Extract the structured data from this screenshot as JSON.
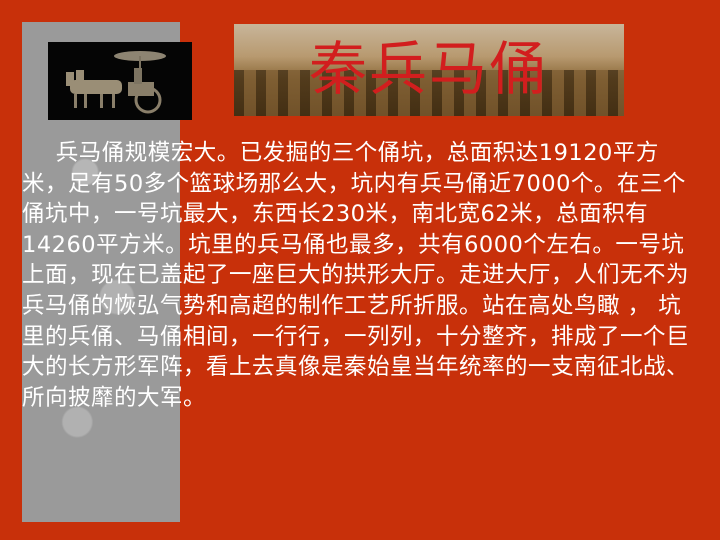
{
  "slide": {
    "title": "秦兵马俑",
    "body": "兵马俑规模宏大。已发掘的三个俑坑，总面积达19120平方米，足有50多个篮球场那么大，坑内有兵马俑近7000个。在三个俑坑中，一号坑最大，东西长230米，南北宽62米，总面积有14260平方米。坑里的兵马俑也最多，共有6000个左右。一号坑上面，现在已盖起了一座巨大的拱形大厅。走进大厅，人们无不为兵马俑的恢弘气势和高超的制作工艺所折服。站在高处鸟瞰 ， 坑里的兵俑、马俑相间，一行行，一列列，十分整齐，排成了一个巨大的长方形军阵，看上去真像是秦始皇当年统率的一支南征北战、所向披靡的大军。"
  },
  "colors": {
    "background": "#c8300a",
    "title": "#d21e1e",
    "body_text": "#ffffff"
  },
  "images": {
    "chariot": "bronze-chariot-photo",
    "banner": "terracotta-pit-photo",
    "side": "grey-dragon-pattern"
  }
}
